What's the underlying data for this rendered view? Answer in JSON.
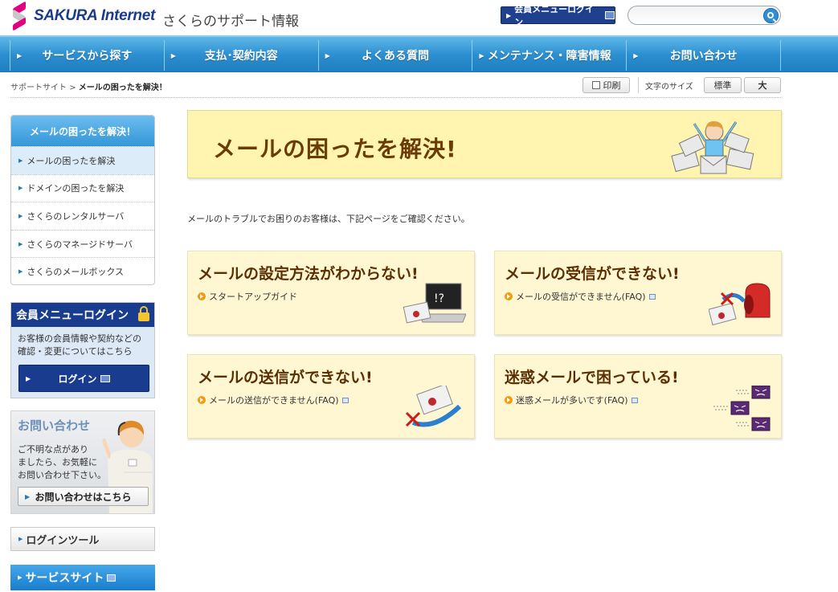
{
  "header": {
    "brand": "SAKURA Internet",
    "site_title": "さくらのサポート情報",
    "login_label": "会員メニューログイン",
    "search_placeholder": ""
  },
  "nav": {
    "items": [
      {
        "label": "サービスから探す"
      },
      {
        "label": "支払･契約内容"
      },
      {
        "label": "よくある質問"
      },
      {
        "label": "メンテナンス・障害情報"
      },
      {
        "label": "お問い合わせ"
      }
    ]
  },
  "breadcrumb": {
    "root": "サポートサイト",
    "separator": ">",
    "current": "メールの困ったを解決！"
  },
  "toolbar": {
    "print_label": "印刷",
    "font_size_label": "文字のサイズ",
    "font_normal": "標準",
    "font_large": "大"
  },
  "sidebar": {
    "heading": "メールの困ったを解決！",
    "items": [
      {
        "label": "メールの困ったを解決"
      },
      {
        "label": "ドメインの困ったを解決"
      },
      {
        "label": "さくらのレンタルサーバ"
      },
      {
        "label": "さくらのマネージドサーバ"
      },
      {
        "label": "さくらのメールボックス"
      }
    ],
    "login_box": {
      "title": "会員メニューログイン",
      "desc_line1": "お客様の会員情報や契約などの",
      "desc_line2": "確認・変更についてはこちら",
      "button": "ログイン"
    },
    "contact_box": {
      "title": "お問い合わせ",
      "desc_line1": "ご不明な点があり",
      "desc_line2": "ましたら、お気軽に",
      "desc_line3": "お問い合わせ下さい。",
      "button": "お問い合わせはこちら"
    },
    "tools_label": "ログインツール",
    "service_label": "サービスサイト"
  },
  "main": {
    "hero_title": "メールの困ったを解決!",
    "intro": "メールのトラブルでお困りのお客様は、下記ページをご確認ください。",
    "cards": [
      {
        "title": "メールの設定方法がわからない!",
        "link": "スタートアップガイド"
      },
      {
        "title": "メールの受信ができない!",
        "link": "メールの受信ができません(FAQ)"
      },
      {
        "title": "メールの送信ができない!",
        "link": "メールの送信ができません(FAQ)"
      },
      {
        "title": "迷惑メールで困っている!",
        "link": "迷惑メールが多いです(FAQ)"
      }
    ]
  },
  "colors": {
    "brand_pink": "#e3007f",
    "brand_navy": "#1a3c8e",
    "nav_blue": "#2c8fd0",
    "hero_yellow": "#fff5b1",
    "card_cream": "#fff7d2",
    "title_brown": "#6b3b06"
  }
}
